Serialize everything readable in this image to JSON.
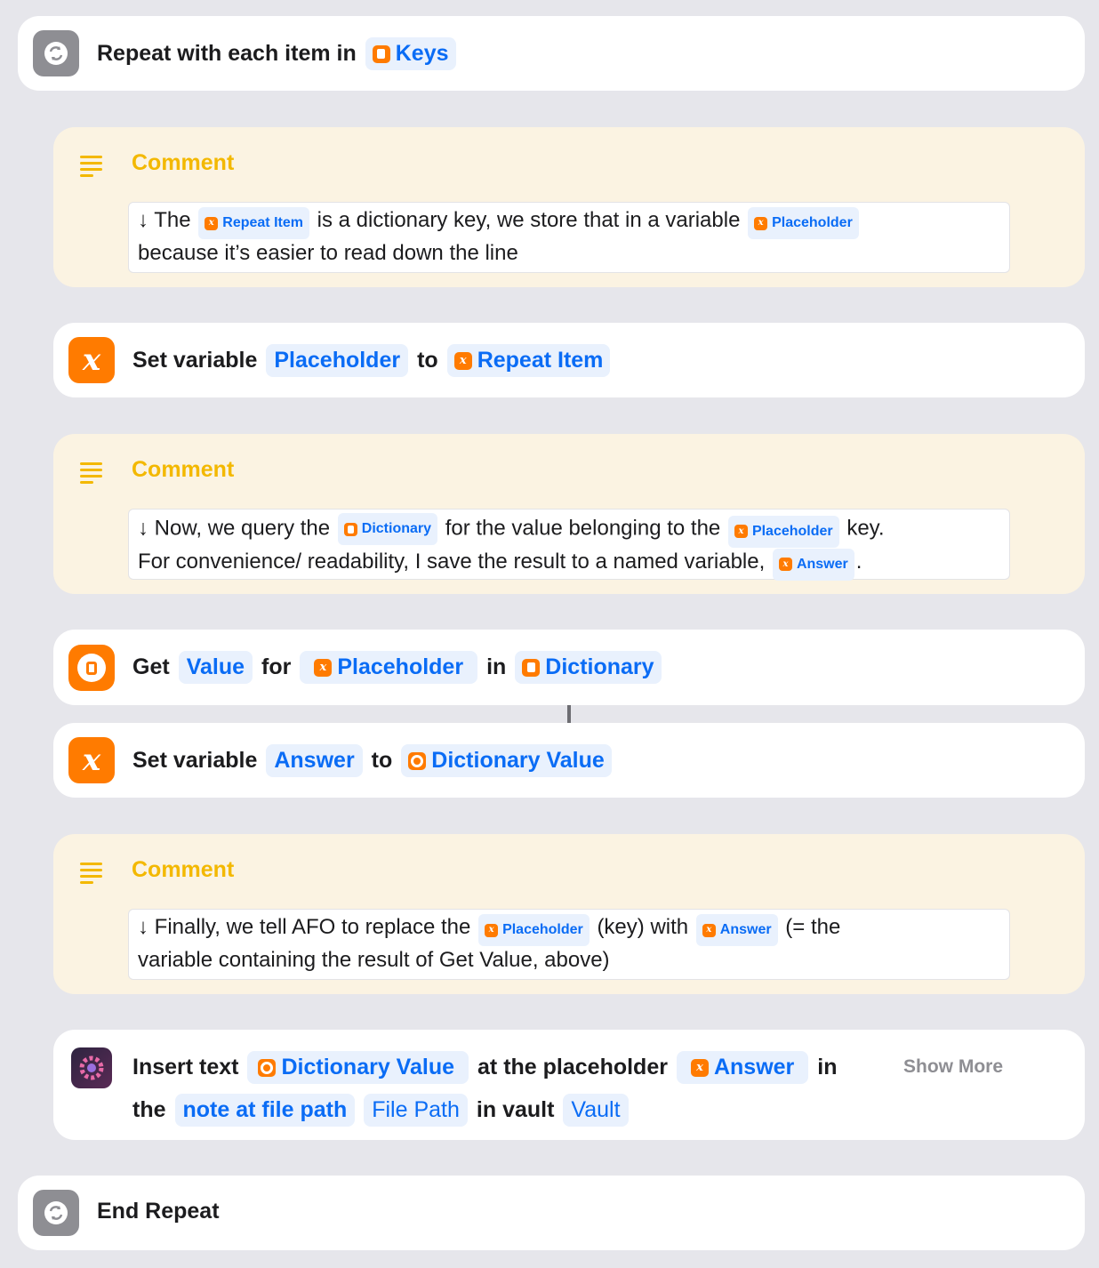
{
  "repeat": {
    "label": "Repeat with each item in",
    "var": "Keys"
  },
  "comment1": {
    "title": "Comment",
    "t1": "↓ The",
    "p1": "Repeat Item",
    "t2": "is a dictionary key, we store that in a variable",
    "p2": "Placeholder",
    "t3": "because it’s easier to read down the line"
  },
  "setvar1": {
    "label": "Set variable",
    "name": "Placeholder",
    "to": "to",
    "value": "Repeat Item"
  },
  "comment2": {
    "title": "Comment",
    "t1": "↓ Now, we query the",
    "p1": "Dictionary",
    "t2": "for the value belonging to the",
    "p2": "Placeholder",
    "t3": "key.",
    "t4": "For convenience/ readability, I save the result to a named variable,",
    "p3": "Answer",
    "t5": "."
  },
  "getvalue": {
    "label": "Get",
    "what": "Value",
    "for": "for",
    "key": "Placeholder",
    "in": "in",
    "dict": "Dictionary"
  },
  "setvar2": {
    "label": "Set variable",
    "name": "Answer",
    "to": "to",
    "value": "Dictionary Value"
  },
  "comment3": {
    "title": "Comment",
    "t1": "↓ Finally, we tell AFO to replace the",
    "p1": "Placeholder",
    "t2": "(key) with",
    "p2": "Answer",
    "t3": "(= the",
    "t4": "variable containing the result of Get Value, above)"
  },
  "insert": {
    "label": "Insert text",
    "value": "Dictionary Value",
    "at": "at the placeholder",
    "placeholder": "Answer",
    "in": "in",
    "the": "the",
    "target": "note at file path",
    "path": "File Path",
    "invault": "in vault",
    "vault": "Vault",
    "show_more": "Show More"
  },
  "end": {
    "label": "End Repeat"
  },
  "colors": {
    "accent": "#0a6cf5",
    "orange": "#ff7b00",
    "comment_title": "#f3b800"
  }
}
